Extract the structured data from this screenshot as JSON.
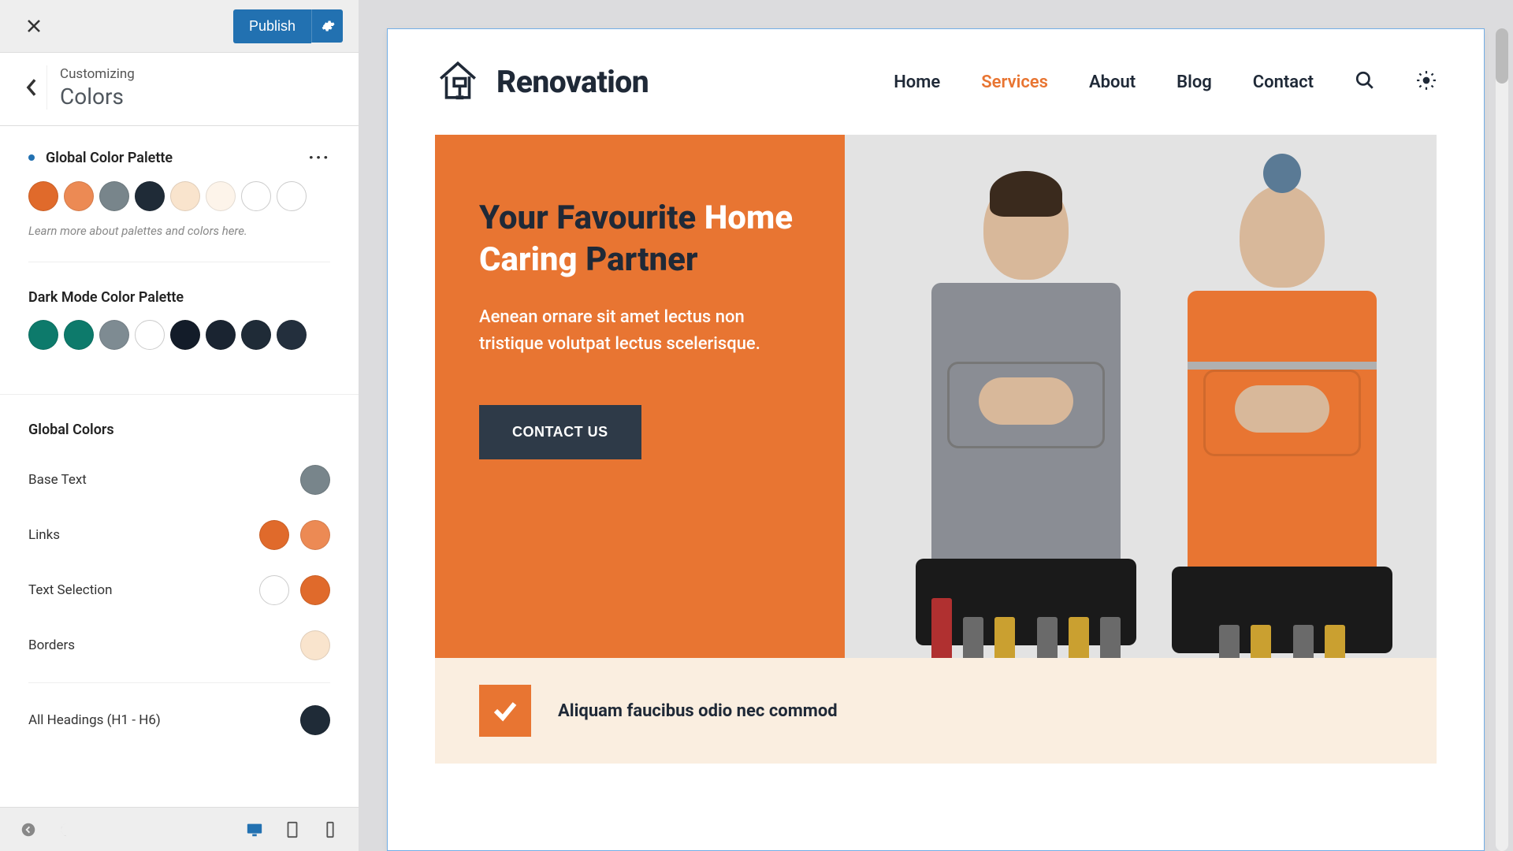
{
  "topbar": {
    "publish_label": "Publish"
  },
  "breadcrumb": {
    "label": "Customizing",
    "title": "Colors"
  },
  "palette": {
    "global_title": "Global Color Palette",
    "dark_title": "Dark Mode Color Palette",
    "hint": "Learn more about palettes and colors here.",
    "global_colors_title": "Global Colors",
    "global_swatches": [
      "#e06a2b",
      "#ec8a54",
      "#78858b",
      "#1f2b37",
      "#f9e4cd",
      "#fdf4ea",
      "#ffffff",
      "#ffffff"
    ],
    "dark_swatches": [
      "#0d7a6b",
      "#0d7a6b",
      "#7e8b92",
      "#ffffff",
      "#131c29",
      "#1a2431",
      "#1f2b37",
      "#232f3d"
    ],
    "rows": [
      {
        "label": "Base Text",
        "colors": [
          "#78858b"
        ]
      },
      {
        "label": "Links",
        "colors": [
          "#e06a2b",
          "#ec8a54"
        ]
      },
      {
        "label": "Text Selection",
        "colors": [
          "#ffffff",
          "#e06a2b"
        ]
      },
      {
        "label": "Borders",
        "colors": [
          "#f9e4cd"
        ]
      },
      {
        "label": "All Headings (H1 - H6)",
        "colors": [
          "#1f2b37"
        ]
      }
    ]
  },
  "site": {
    "brand": "Renovation",
    "nav": [
      "Home",
      "Services",
      "About",
      "Blog",
      "Contact"
    ],
    "nav_active_index": 1,
    "hero": {
      "title_pre": "Your Favourite ",
      "title_highlight": "Home Caring ",
      "title_post": "Partner",
      "desc": "Aenean ornare sit amet lectus non tristique volutpat lectus scelerisque.",
      "button": "CONTACT US"
    },
    "info_text": "Aliquam faucibus odio nec commod"
  }
}
